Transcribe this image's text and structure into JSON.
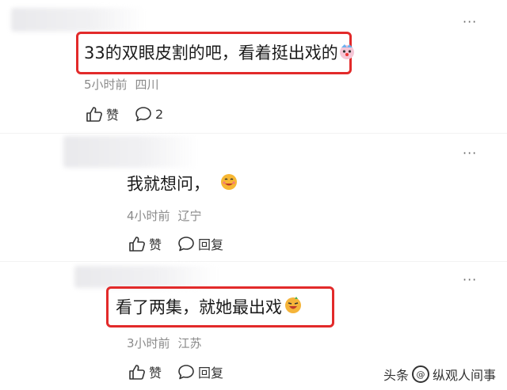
{
  "comments": [
    {
      "text": "33的双眼皮割的吧，看着挺出戏的",
      "emoji": "clown-face-icon",
      "time": "5小时前",
      "location": "四川",
      "like_label": "赞",
      "reply_count": "2"
    },
    {
      "text": "我就想问，",
      "emoji": "smile-face-icon",
      "time": "4小时前",
      "location": "辽宁",
      "like_label": "赞",
      "reply_label": "回复"
    },
    {
      "text": "看了两集，就她最出戏",
      "emoji": "laugh-face-icon",
      "time": "3小时前",
      "location": "江苏",
      "like_label": "赞",
      "reply_label": "回复"
    }
  ],
  "more_glyph": "···",
  "watermark": {
    "left": "头条",
    "right": "纵观人间事"
  },
  "colors": {
    "highlight": "#e22a2a",
    "meta": "#8a8a8a"
  }
}
